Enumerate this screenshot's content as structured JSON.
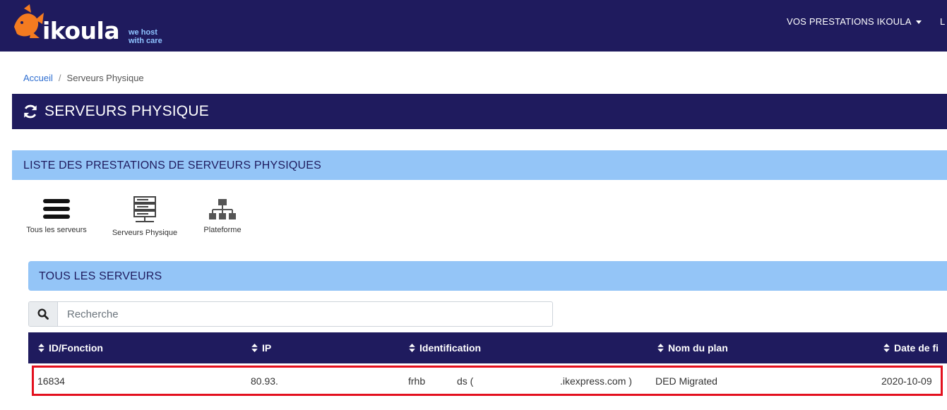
{
  "brand": {
    "name": "ikoula",
    "tagline_1": "we host",
    "tagline_2": "with care"
  },
  "nav": {
    "prestations": "VOS PRESTATIONS IKOULA",
    "next_item": "L"
  },
  "breadcrumb": {
    "home": "Accueil",
    "current": "Serveurs Physique"
  },
  "page": {
    "title": "SERVEURS PHYSIQUE"
  },
  "section": {
    "title": "LISTE DES PRESTATIONS DE SERVEURS PHYSIQUES"
  },
  "filters": [
    {
      "label": "Tous les serveurs",
      "icon": "list-icon"
    },
    {
      "label": "Serveurs Physique",
      "icon": "server-icon"
    },
    {
      "label": "Plateforme",
      "icon": "sitemap-icon"
    }
  ],
  "subsection": {
    "title": "TOUS LES SERVEURS"
  },
  "search": {
    "placeholder": "Recherche",
    "value": ""
  },
  "table": {
    "columns": [
      "ID/Fonction",
      "IP",
      "Identification",
      "Nom du plan",
      "Date de fi"
    ],
    "rows": [
      {
        "id": "16834",
        "ip": "80.93.",
        "ident_a": "frhb",
        "ident_b": "ds (",
        "ident_c": ".ikexpress.com )",
        "plan": "DED Migrated",
        "date": "2020-10-09"
      }
    ]
  },
  "colors": {
    "navy": "#1f1b5e",
    "light_blue": "#94c5f7",
    "logo_orange": "#f47b20",
    "highlight_red": "#e3101e"
  }
}
